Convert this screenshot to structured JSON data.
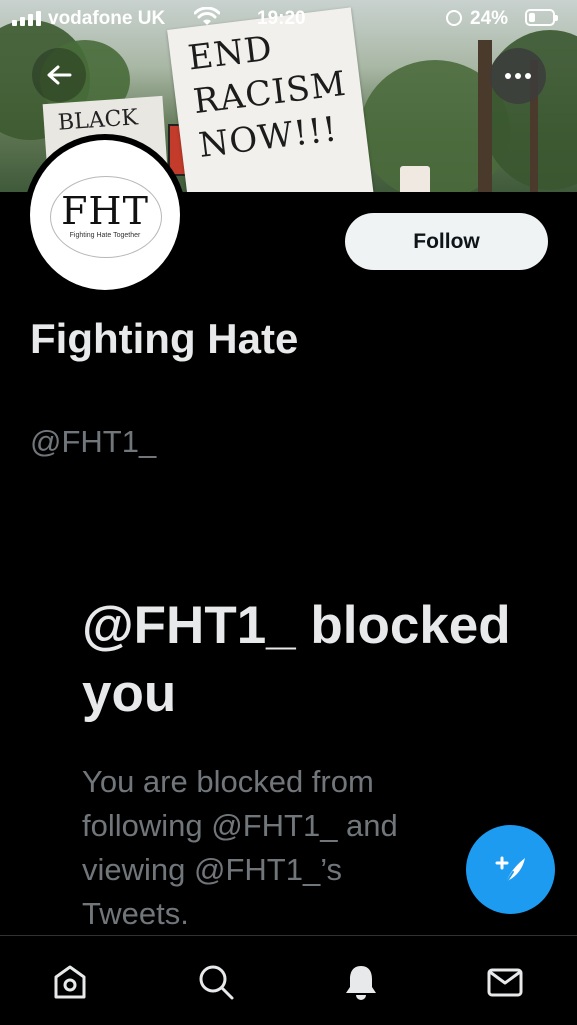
{
  "status_bar": {
    "carrier": "vodafone UK",
    "time": "19:20",
    "battery_percent": "24%"
  },
  "banner": {
    "sign_text": "END\nRACISM\nNOW!!!",
    "sign_left_text": "BLACK"
  },
  "profile": {
    "avatar_logo": "FHT",
    "avatar_subtitle": "Fighting Hate Together",
    "display_name": "Fighting Hate",
    "handle": "@FHT1_",
    "follow_label": "Follow"
  },
  "blocked": {
    "title": "@FHT1_ blocked you",
    "description": "You are blocked from following @FHT1_ and viewing @FHT1_’s Tweets."
  },
  "icons": {
    "back": "arrow-left-icon",
    "more": "more-icon",
    "compose": "compose-tweet-icon",
    "home": "home-icon",
    "search": "search-icon",
    "notifications": "bell-icon",
    "messages": "mail-icon"
  },
  "colors": {
    "accent": "#1d9bf0",
    "background": "#000000",
    "text_primary": "#e7e9ea",
    "text_secondary": "#71767b",
    "follow_bg": "#eff3f4"
  }
}
